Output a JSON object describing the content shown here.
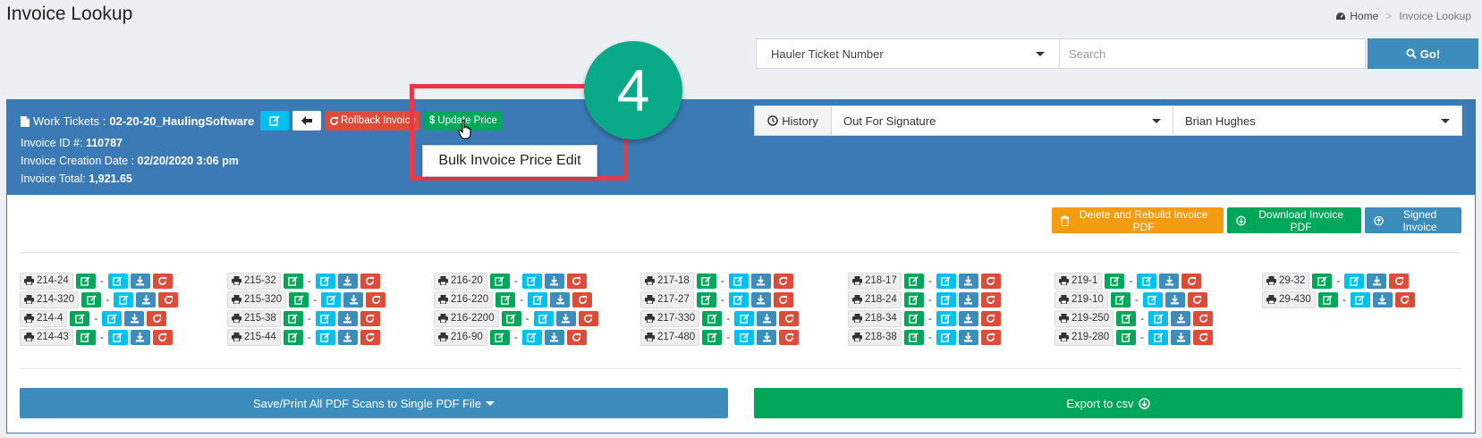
{
  "page": {
    "title": "Invoice Lookup",
    "breadcrumb": {
      "home": "Home",
      "separator": ">",
      "current": "Invoice Lookup"
    }
  },
  "search": {
    "type_selected": "Hauler Ticket Number",
    "placeholder": "Search",
    "go_label": "Go!"
  },
  "invoice": {
    "work_tickets_label": "Work Tickets :",
    "work_tickets_value": "02-20-20_HaulingSoftware",
    "id_label": "Invoice ID #:",
    "id_value": "110787",
    "date_label": "Invoice Creation Date :",
    "date_value": "02/20/2020 3:06 pm",
    "total_label": "Invoice Total:",
    "total_value": "1,921.65",
    "rollback_label": "Rollback Invoice",
    "update_price_label": "Update Price"
  },
  "tooltip": {
    "text": "Bulk Invoice Price Edit"
  },
  "step_badge": "4",
  "status": {
    "history_label": "History",
    "status_selected": "Out For Signature",
    "user_selected": "Brian Hughes"
  },
  "actions": {
    "delete_rebuild": "Delete and Rebuild Invoice PDF",
    "download": "Download Invoice PDF",
    "signed": "Signed Invoice"
  },
  "ticket_columns": [
    [
      "214-24",
      "214-320",
      "214-4",
      "214-43"
    ],
    [
      "215-32",
      "215-320",
      "215-38",
      "215-44"
    ],
    [
      "216-20",
      "216-220",
      "216-2200",
      "216-90"
    ],
    [
      "217-18",
      "217-27",
      "217-330",
      "217-480"
    ],
    [
      "218-17",
      "218-24",
      "218-34",
      "218-38"
    ],
    [
      "219-1",
      "219-10",
      "219-250",
      "219-280"
    ],
    [
      "29-32",
      "29-430"
    ]
  ],
  "footer": {
    "save_print": "Save/Print All PDF Scans to Single PDF File",
    "export_csv": "Export to csv"
  },
  "colors": {
    "header_blue": "#3c7ab5",
    "primary": "#3c8dbc",
    "success": "#00a65a",
    "info": "#00c0ef",
    "danger": "#dd4b39",
    "warning": "#f39c12",
    "callout_red": "#e8394a",
    "step_teal": "#0aaa88"
  }
}
